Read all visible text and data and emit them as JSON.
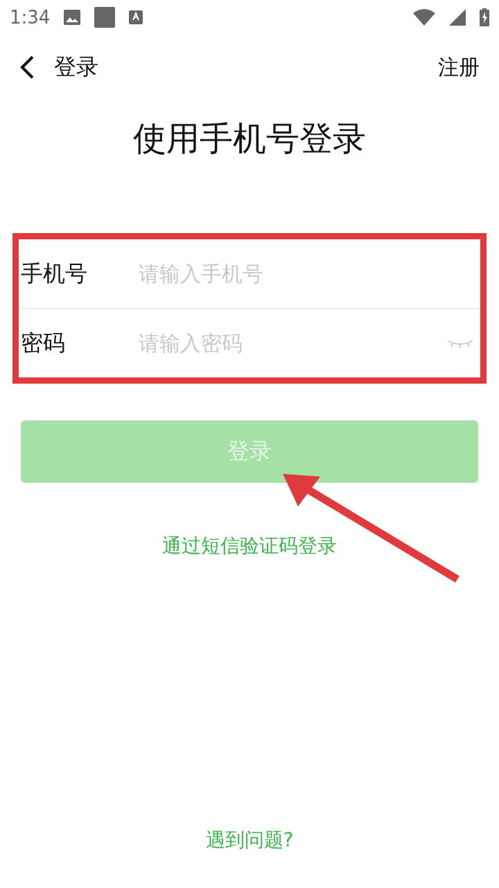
{
  "status_bar": {
    "time": "1:34"
  },
  "header": {
    "title": "登录",
    "action": "注册"
  },
  "heading": "使用手机号登录",
  "fields": [
    {
      "kind": "text",
      "label": "手机号",
      "placeholder": "请输入手机号"
    },
    {
      "kind": "password",
      "label": "密码",
      "placeholder": "请输入密码"
    }
  ],
  "login_button": {
    "label": "登录",
    "disabled": true
  },
  "sms_link": "通过短信验证码登录",
  "help_link": "遇到问题?"
}
